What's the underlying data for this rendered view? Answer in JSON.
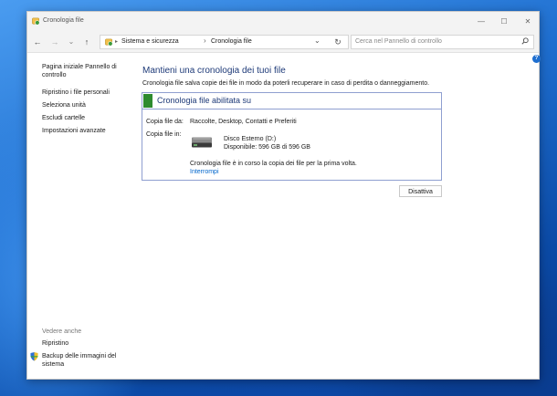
{
  "window": {
    "title": "Cronologia file"
  },
  "titlebar": {
    "minimize": "—",
    "maximize": "☐",
    "close": "✕"
  },
  "nav": {
    "back": "←",
    "forward": "→",
    "recent": "⌄",
    "up": "↑"
  },
  "address": {
    "crumbs": [
      "Sistema e sicurezza",
      "Cronologia file"
    ],
    "separator": "›",
    "dropdown": "⌄",
    "refresh": "↻"
  },
  "search": {
    "placeholder": "Cerca nel Pannello di controllo"
  },
  "help": {
    "label": "?"
  },
  "sidebar": {
    "home_line1": "Pagina iniziale Pannello di",
    "home_line2": "controllo",
    "items": [
      "Ripristino i file personali",
      "Seleziona unità",
      "Escludi cartelle",
      "Impostazioni avanzate"
    ]
  },
  "see_also": {
    "heading": "Vedere anche",
    "recovery": "Ripristino",
    "backup_line1": "Backup delle immagini del",
    "backup_line2": "sistema"
  },
  "main": {
    "title": "Mantieni una cronologia dei tuoi file",
    "description": "Cronologia file salva copie dei file in modo da poterli recuperare in caso di perdita o danneggiamento."
  },
  "status": {
    "title": "Cronologia file abilitata su",
    "color": "#2e8b2e",
    "copy_from_label": "Copia file da:",
    "copy_from_value": "Raccolte, Desktop, Contatti e Preferiti",
    "copy_to_label": "Copia file in:",
    "drive_name": "Disco Esterno (D:)",
    "drive_available": "Disponibile: 596 GB di 596 GB",
    "progress_message": "Cronologia file è in corso la copia dei file per la prima volta.",
    "stop_link": "Interrompi"
  },
  "actions": {
    "disable": "Disattiva"
  }
}
